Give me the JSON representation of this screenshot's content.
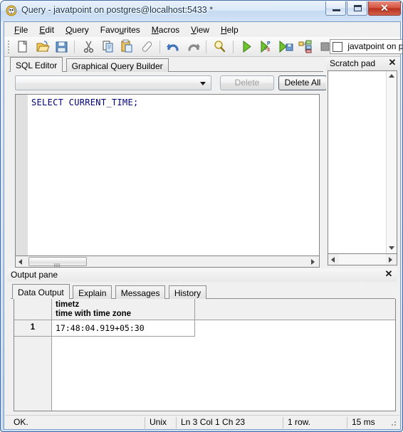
{
  "window": {
    "title": "Query - javatpoint on postgres@localhost:5433 *",
    "app_icon": "pgadmin-elephant-icon",
    "caption": {
      "minimize": "minimize-button",
      "maximize": "maximize-button",
      "close": "✕"
    }
  },
  "menubar": {
    "items": [
      {
        "label": "File",
        "accel": "F"
      },
      {
        "label": "Edit",
        "accel": "E"
      },
      {
        "label": "Query",
        "accel": "Q"
      },
      {
        "label": "Favourites",
        "accel": "u"
      },
      {
        "label": "Macros",
        "accel": "M"
      },
      {
        "label": "View",
        "accel": "V"
      },
      {
        "label": "Help",
        "accel": "H"
      }
    ]
  },
  "toolbar": {
    "buttons": [
      {
        "name": "new-file-icon",
        "title": "New"
      },
      {
        "name": "open-file-icon",
        "title": "Open"
      },
      {
        "name": "save-file-icon",
        "title": "Save"
      },
      {
        "name": "cut-icon",
        "title": "Cut"
      },
      {
        "name": "copy-icon",
        "title": "Copy"
      },
      {
        "name": "paste-icon",
        "title": "Paste"
      },
      {
        "name": "clear-eraser-icon",
        "title": "Clear window"
      },
      {
        "name": "undo-icon",
        "title": "Undo"
      },
      {
        "name": "redo-icon",
        "title": "Redo"
      },
      {
        "name": "find-replace-icon",
        "title": "Find"
      },
      {
        "name": "execute-query-icon",
        "title": "Execute query"
      },
      {
        "name": "explain-query-icon",
        "title": "Explain query"
      },
      {
        "name": "execute-to-file-icon",
        "title": "Execute to file"
      },
      {
        "name": "explain-analyze-icon",
        "title": "Explain analyze"
      },
      {
        "name": "stop-icon",
        "title": "Cancel"
      },
      {
        "name": "help-icon",
        "title": "Help"
      }
    ],
    "database_selector": {
      "label": "javatpoint on postg",
      "checked": false
    }
  },
  "editor": {
    "tabs": [
      {
        "label": "SQL Editor",
        "active": true
      },
      {
        "label": "Graphical Query Builder",
        "active": false
      }
    ],
    "history_combo": {
      "value": "",
      "placeholder": ""
    },
    "delete_button": {
      "label": "Delete",
      "enabled": false
    },
    "delete_all_button": {
      "label": "Delete All",
      "enabled": true
    },
    "sql_text": "SELECT CURRENT_TIME;",
    "sql_color": "#00007f"
  },
  "scratch_pad": {
    "title": "Scratch pad",
    "close": "✕",
    "content": ""
  },
  "output_pane": {
    "title": "Output pane",
    "close": "✕",
    "tabs": [
      {
        "label": "Data Output",
        "active": true
      },
      {
        "label": "Explain",
        "active": false
      },
      {
        "label": "Messages",
        "active": false
      },
      {
        "label": "History",
        "active": false
      }
    ],
    "grid": {
      "columns": [
        {
          "name": "timetz",
          "type": "time with time zone"
        }
      ],
      "rows": [
        {
          "number": "1",
          "values": [
            "17:48:04.919+05:30"
          ]
        }
      ]
    }
  },
  "statusbar": {
    "message": "OK.",
    "line_ending": "Unix",
    "position": "Ln 3 Col 1 Ch 23",
    "rows": "1 row.",
    "duration": "15 ms"
  },
  "colors": {
    "frame": "#4b6fa5",
    "title_gradient_top": "#e8f1fb",
    "chrome": "#f0f0f0",
    "sql_keyword": "#00007f",
    "close_red": "#b6301d"
  }
}
